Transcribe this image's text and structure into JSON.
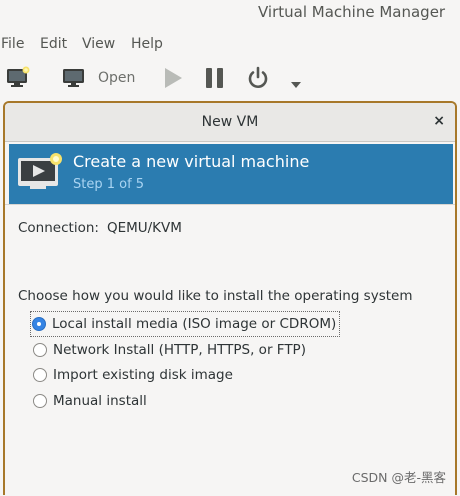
{
  "app": {
    "title": "Virtual Machine Manager"
  },
  "menubar": {
    "items": [
      "File",
      "Edit",
      "View",
      "Help"
    ]
  },
  "toolbar": {
    "new_vm_icon": "new-vm-icon",
    "open_icon": "monitor-icon",
    "open_label": "Open",
    "run_icon": "play-icon",
    "pause_icon": "pause-icon",
    "shutdown_icon": "power-icon",
    "dropdown_icon": "chevron-down-icon"
  },
  "dialog": {
    "title": "New VM",
    "close_label": "×",
    "banner": {
      "title": "Create a new virtual machine",
      "step": "Step 1 of 5",
      "color": "#2b7cb0"
    },
    "connection_label": "Connection:",
    "connection_value": "QEMU/KVM",
    "install_prompt": "Choose how you would like to install the operating system",
    "options": [
      {
        "label": "Local install media (ISO image or CDROM)",
        "selected": true
      },
      {
        "label": "Network Install (HTTP, HTTPS, or FTP)",
        "selected": false
      },
      {
        "label": "Import existing disk image",
        "selected": false
      },
      {
        "label": "Manual install",
        "selected": false
      }
    ]
  },
  "watermark": "CSDN @老-黑客"
}
